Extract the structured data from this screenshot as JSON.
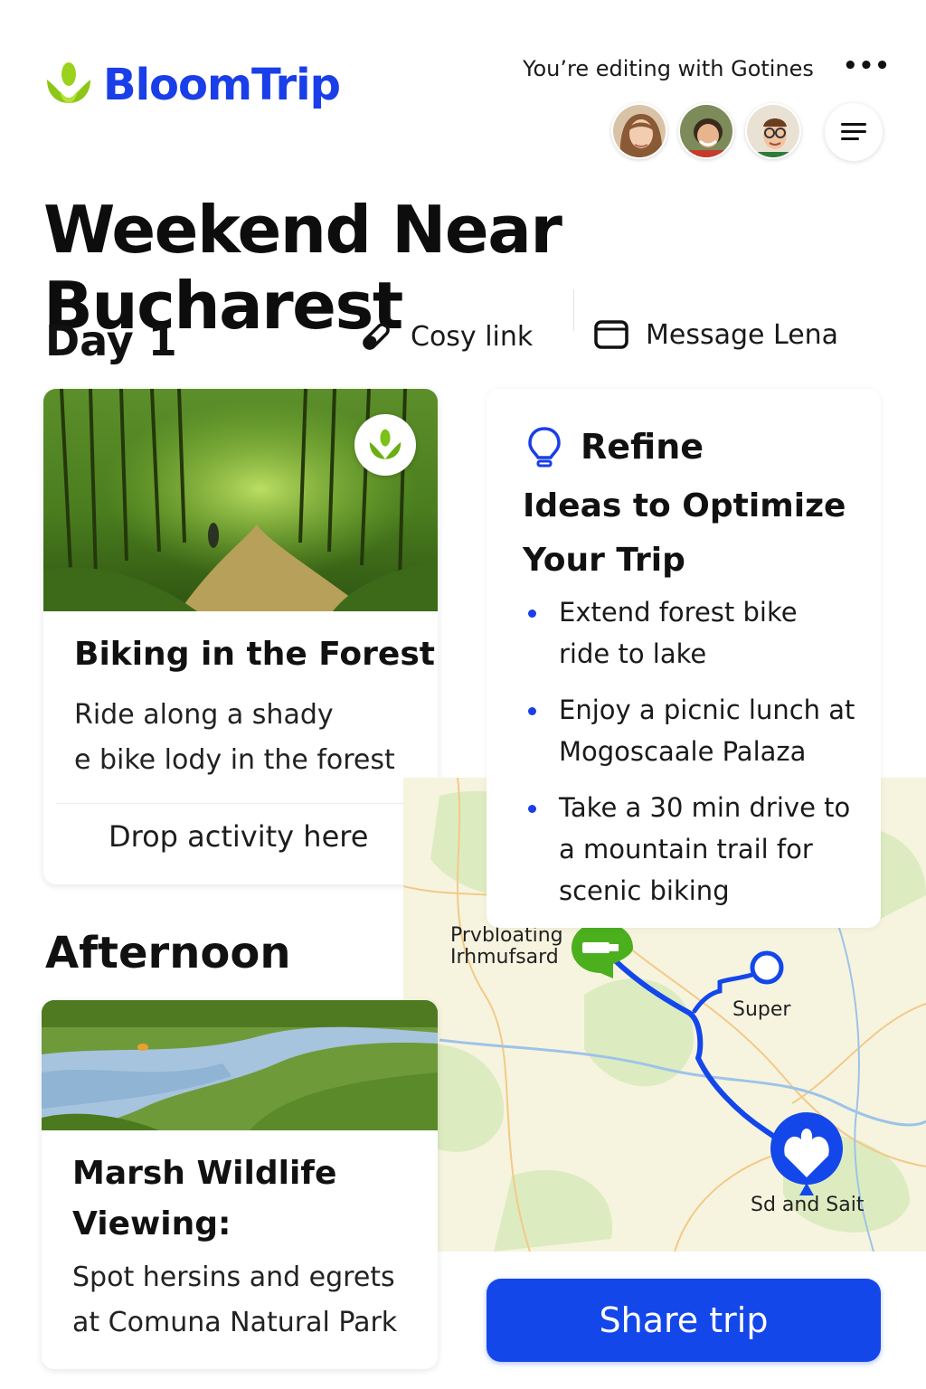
{
  "brand": {
    "name": "BloomTrip",
    "logo_icon": "bloom-leaf-icon",
    "color": "#1a3ee8",
    "leaf_color": "#9bd21c"
  },
  "header": {
    "collab_text": "You’re editing with Gotines",
    "more_icon": "more-dots-icon",
    "menu_icon": "hamburger-icon"
  },
  "trip": {
    "title": "Weekend Near Bucharest"
  },
  "day": {
    "label": "Day 1",
    "actions": {
      "copy_link": "Cosy link",
      "message": "Message Lena"
    }
  },
  "activities": [
    {
      "title": "Biking in the Forest",
      "desc_line1": "Ride along a shady",
      "desc_line2": "e bike lody in the forest",
      "drop_text": "Drop activity here"
    }
  ],
  "afternoon": {
    "label": "Afternoon",
    "activity": {
      "title_line1": "Marsh Wildlife",
      "title_line2": "Viewing:",
      "desc_line1": "Spot hersins and egrets",
      "desc_line2": "at Comuna Natural Park"
    }
  },
  "refine": {
    "label": "Refine",
    "title_line1": "Ideas to Optimize",
    "title_line2": "Your Trip",
    "tips": [
      {
        "line1": "Extend forest bike",
        "line2": "ride to lake"
      },
      {
        "line1": "Enjoy a picnic lunch at",
        "line2": "Mogoscaale Palaza"
      },
      {
        "line1": "Take a 30 min drive to",
        "line2": "a mountain trail for",
        "line3": "scenic biking"
      }
    ]
  },
  "map": {
    "labels": {
      "start_line1": "Prvbloating",
      "start_line2": "Irhmufsard",
      "mid": "Super",
      "end": "Sd and Sait"
    },
    "route_color": "#1447ea",
    "start_color": "#4caf1e"
  },
  "share": {
    "label": "Share trip"
  }
}
